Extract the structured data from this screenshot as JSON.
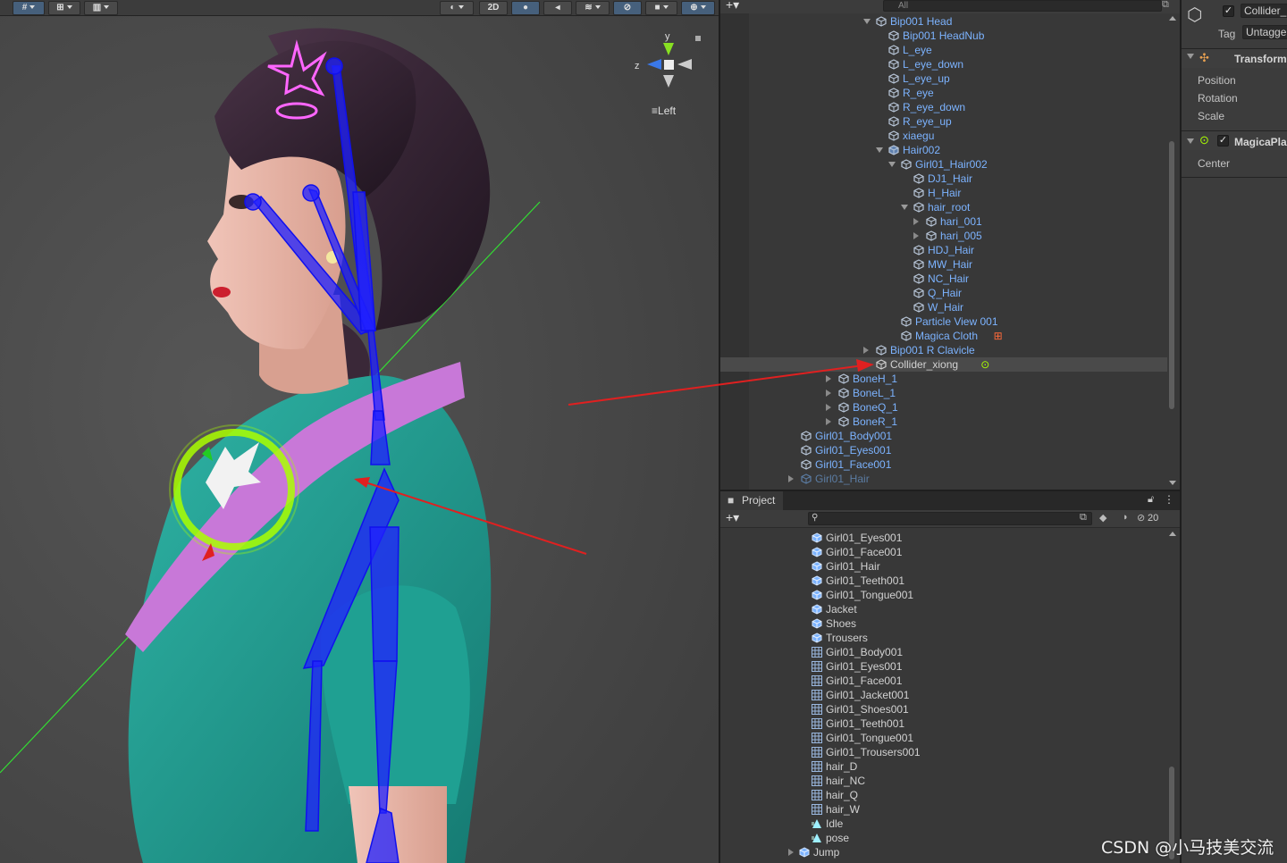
{
  "scene": {
    "toolbar": {
      "mode_2d": "2D"
    },
    "gizmo": {
      "view_label": "Left",
      "axis_y": "y",
      "axis_z": "z"
    }
  },
  "hierarchy": {
    "search_placeholder": "All",
    "rows": [
      {
        "label": "Bip001 Head",
        "color": "blue",
        "indent": 0,
        "arrow": "down"
      },
      {
        "label": "Bip001 HeadNub",
        "color": "blue",
        "indent": 1,
        "arrow": ""
      },
      {
        "label": "L_eye",
        "color": "blue",
        "indent": 1,
        "arrow": ""
      },
      {
        "label": "L_eye_down",
        "color": "blue",
        "indent": 1,
        "arrow": ""
      },
      {
        "label": "L_eye_up",
        "color": "blue",
        "indent": 1,
        "arrow": ""
      },
      {
        "label": "R_eye",
        "color": "blue",
        "indent": 1,
        "arrow": ""
      },
      {
        "label": "R_eye_down",
        "color": "blue",
        "indent": 1,
        "arrow": ""
      },
      {
        "label": "R_eye_up",
        "color": "blue",
        "indent": 1,
        "arrow": ""
      },
      {
        "label": "xiaegu",
        "color": "blue",
        "indent": 1,
        "arrow": ""
      },
      {
        "label": "Hair002",
        "color": "blue",
        "indent": 1,
        "arrow": "down",
        "icon": "prefab"
      },
      {
        "label": "Girl01_Hair002",
        "color": "blue",
        "indent": 2,
        "arrow": "down"
      },
      {
        "label": "DJ1_Hair",
        "color": "blue",
        "indent": 3,
        "arrow": ""
      },
      {
        "label": "H_Hair",
        "color": "blue",
        "indent": 3,
        "arrow": ""
      },
      {
        "label": "hair_root",
        "color": "blue",
        "indent": 3,
        "arrow": "down"
      },
      {
        "label": "hari_001",
        "color": "blue",
        "indent": 4,
        "arrow": "right"
      },
      {
        "label": "hari_005",
        "color": "blue",
        "indent": 4,
        "arrow": "right"
      },
      {
        "label": "HDJ_Hair",
        "color": "blue",
        "indent": 3,
        "arrow": ""
      },
      {
        "label": "MW_Hair",
        "color": "blue",
        "indent": 3,
        "arrow": ""
      },
      {
        "label": "NC_Hair",
        "color": "blue",
        "indent": 3,
        "arrow": ""
      },
      {
        "label": "Q_Hair",
        "color": "blue",
        "indent": 3,
        "arrow": ""
      },
      {
        "label": "W_Hair",
        "color": "blue",
        "indent": 3,
        "arrow": ""
      },
      {
        "label": "Particle View 001",
        "color": "blue",
        "indent": 2,
        "arrow": ""
      },
      {
        "label": "Magica Cloth",
        "color": "blue",
        "indent": 2,
        "arrow": "",
        "badge": "cloth"
      },
      {
        "label": "Bip001 R Clavicle",
        "color": "blue",
        "indent": 0,
        "arrow": "right"
      },
      {
        "label": "Collider_xiong",
        "color": "white",
        "indent": 0,
        "arrow": "",
        "selected": true,
        "badge": "collider"
      },
      {
        "label": "BoneH_1",
        "color": "blue",
        "indent": -3,
        "arrow": "right"
      },
      {
        "label": "BoneL_1",
        "color": "blue",
        "indent": -3,
        "arrow": "right"
      },
      {
        "label": "BoneQ_1",
        "color": "blue",
        "indent": -3,
        "arrow": "right"
      },
      {
        "label": "BoneR_1",
        "color": "blue",
        "indent": -3,
        "arrow": "right"
      },
      {
        "label": "Girl01_Body001",
        "color": "blue",
        "indent": -6,
        "arrow": ""
      },
      {
        "label": "Girl01_Eyes001",
        "color": "blue",
        "indent": -6,
        "arrow": ""
      },
      {
        "label": "Girl01_Face001",
        "color": "blue",
        "indent": -6,
        "arrow": ""
      },
      {
        "label": "Girl01_Hair",
        "color": "dim",
        "indent": -6,
        "arrow": "right"
      }
    ]
  },
  "project": {
    "tab_label": "Project",
    "hidden_count": "20",
    "items": [
      {
        "label": "Girl01_Eyes001",
        "icon": "prefab"
      },
      {
        "label": "Girl01_Face001",
        "icon": "prefab"
      },
      {
        "label": "Girl01_Hair",
        "icon": "prefab"
      },
      {
        "label": "Girl01_Teeth001",
        "icon": "prefab"
      },
      {
        "label": "Girl01_Tongue001",
        "icon": "prefab"
      },
      {
        "label": "Jacket",
        "icon": "prefab"
      },
      {
        "label": "Shoes",
        "icon": "prefab"
      },
      {
        "label": "Trousers",
        "icon": "prefab"
      },
      {
        "label": "Girl01_Body001",
        "icon": "mesh"
      },
      {
        "label": "Girl01_Eyes001",
        "icon": "mesh"
      },
      {
        "label": "Girl01_Face001",
        "icon": "mesh"
      },
      {
        "label": "Girl01_Jacket001",
        "icon": "mesh"
      },
      {
        "label": "Girl01_Shoes001",
        "icon": "mesh"
      },
      {
        "label": "Girl01_Teeth001",
        "icon": "mesh"
      },
      {
        "label": "Girl01_Tongue001",
        "icon": "mesh"
      },
      {
        "label": "Girl01_Trousers001",
        "icon": "mesh"
      },
      {
        "label": "hair_D",
        "icon": "mesh"
      },
      {
        "label": "hair_NC",
        "icon": "mesh"
      },
      {
        "label": "hair_Q",
        "icon": "mesh"
      },
      {
        "label": "hair_W",
        "icon": "mesh"
      },
      {
        "label": "Idle",
        "icon": "anim"
      },
      {
        "label": "pose",
        "icon": "anim"
      },
      {
        "label": "Jump",
        "icon": "prefab",
        "expandable": true
      }
    ]
  },
  "inspector": {
    "object_name": "Collider_",
    "tag_label": "Tag",
    "tag_value": "Untagge",
    "transform_title": "Transform",
    "position_label": "Position",
    "rotation_label": "Rotation",
    "scale_label": "Scale",
    "component_title": "MagicaPla",
    "center_label": "Center"
  },
  "watermark": "CSDN @小马技美交流",
  "colors": {
    "hierarchy_blue": "#7cb3ff",
    "selection": "#4a4a4a",
    "annotation_arrow": "#e02020",
    "bone_blue": "#1a1aff",
    "collider_green": "#aaff00"
  }
}
